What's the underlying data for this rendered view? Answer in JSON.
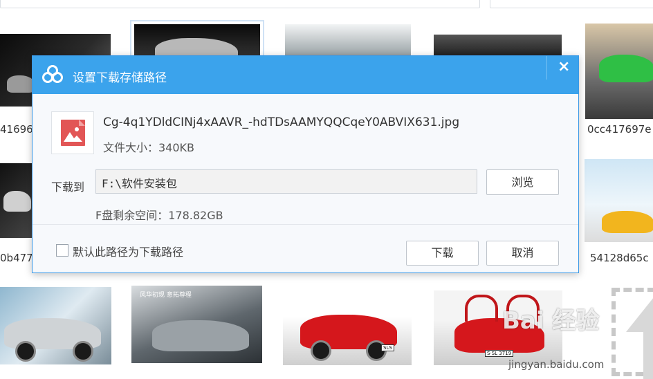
{
  "gallery": {
    "captions": {
      "row1_col1": "41696",
      "row1_col5": "0cc417697e",
      "row2_col1": "0b477",
      "row2_col5": "54128d65c"
    },
    "plates": {
      "row3_col3": "SLS",
      "row3_col4": "S·SL 3719"
    },
    "poster_text": "风华初现 意拓尊程"
  },
  "dialog": {
    "title": "设置下载存储路径",
    "close_glyph": "×",
    "file": {
      "name": "Cg-4q1YDldCINj4xAAVR_-hdTDsAAMYQQCqeY0ABVIX631.jpg",
      "size": "文件大小：340KB",
      "icon": "image-file-icon"
    },
    "download_to_label": "下载到",
    "path_value": "F:\\软件安装包",
    "browse_label": "浏览",
    "free_space": "F盘剩余空间：178.82GB",
    "default_path_label": "默认此路径为下载路径",
    "default_path_checked": false,
    "download_label": "下载",
    "cancel_label": "取消"
  },
  "watermark": {
    "text": "Bai 经验",
    "url": "jingyan.baidu.com"
  },
  "colors": {
    "accent": "#3ba3ec",
    "file_icon": "#e25656"
  }
}
